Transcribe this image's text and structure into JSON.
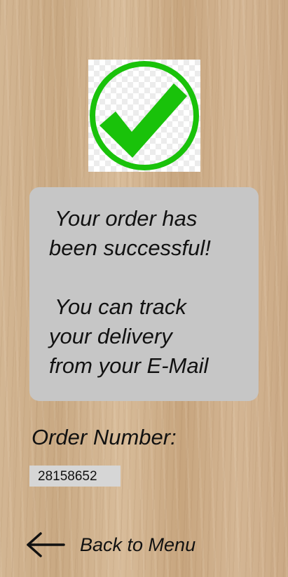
{
  "success_icon": {
    "icon": "checkmark-circle-icon",
    "color": "#19c20a"
  },
  "message": {
    "line1": " Your order has",
    "line2": "been successful!",
    "line3": " You can track",
    "line4": "your delivery",
    "line5": "from your E-Mail"
  },
  "order": {
    "label": "Order Number:",
    "number": "28158652"
  },
  "back": {
    "icon": "arrow-left-icon",
    "label": "Back to Menu"
  }
}
